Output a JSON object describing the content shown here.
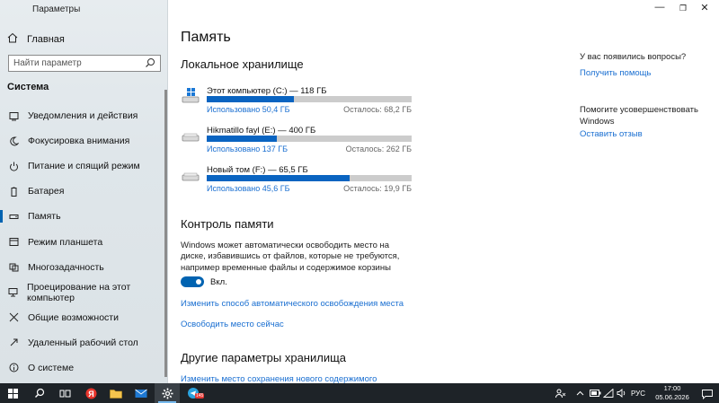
{
  "window": {
    "title": "Параметры",
    "minimize": "—",
    "maximize": "❐",
    "close": "✕"
  },
  "sidebar": {
    "home_label": "Главная",
    "search_placeholder": "Найти параметр",
    "section": "Система",
    "items": [
      {
        "label": "Уведомления и действия",
        "icon": "notifications-icon"
      },
      {
        "label": "Фокусировка внимания",
        "icon": "moon-icon"
      },
      {
        "label": "Питание и спящий режим",
        "icon": "power-icon"
      },
      {
        "label": "Батарея",
        "icon": "battery-icon"
      },
      {
        "label": "Память",
        "icon": "storage-icon",
        "active": true
      },
      {
        "label": "Режим планшета",
        "icon": "tablet-icon"
      },
      {
        "label": "Многозадачность",
        "icon": "multitask-icon"
      },
      {
        "label": "Проецирование на этот компьютер",
        "icon": "projecting-icon"
      },
      {
        "label": "Общие возможности",
        "icon": "shared-icon"
      },
      {
        "label": "Удаленный рабочий стол",
        "icon": "remote-desktop-icon"
      },
      {
        "label": "О системе",
        "icon": "info-icon"
      }
    ]
  },
  "main": {
    "title": "Память",
    "local_storage_heading": "Локальное хранилище",
    "drives": [
      {
        "name": "Этот компьютер (C:) — 118 ГБ",
        "used": "Использовано 50,4 ГБ",
        "free": "Осталось: 68,2 ГБ",
        "used_fraction": 0.427,
        "system": true
      },
      {
        "name": "Hikmatillo fayl (E:) — 400 ГБ",
        "used": "Использовано 137 ГБ",
        "free": "Осталось: 262 ГБ",
        "used_fraction": 0.343,
        "system": false
      },
      {
        "name": "Новый том (F:) — 65,5 ГБ",
        "used": "Использовано 45,6 ГБ",
        "free": "Осталось: 19,9 ГБ",
        "used_fraction": 0.696,
        "system": false
      }
    ],
    "storage_sense_heading": "Контроль памяти",
    "storage_sense_text": "Windows может автоматически освободить место на диске, избавившись от файлов, которые не требуются, например временные файлы и содержимое корзины",
    "toggle_label": "Вкл.",
    "link_configure": "Изменить способ автоматического освобождения места",
    "link_free_now": "Освободить место сейчас",
    "other_heading": "Другие параметры хранилища",
    "link_change_location": "Изменить место сохранения нового содержимого"
  },
  "right": {
    "question": "У вас появились вопросы?",
    "get_help": "Получить помощь",
    "improve": "Помогите усовершенствовать Windows",
    "feedback": "Оставить отзыв"
  },
  "taskbar": {
    "lang": "РУС",
    "time": "17:00",
    "date": "05.06.2026",
    "telegram_badge": "145",
    "accent": "#76b9ed"
  },
  "colors": {
    "accent": "#0063b1",
    "link": "#1a6fd1",
    "bar_fill": "#0a64c1"
  }
}
